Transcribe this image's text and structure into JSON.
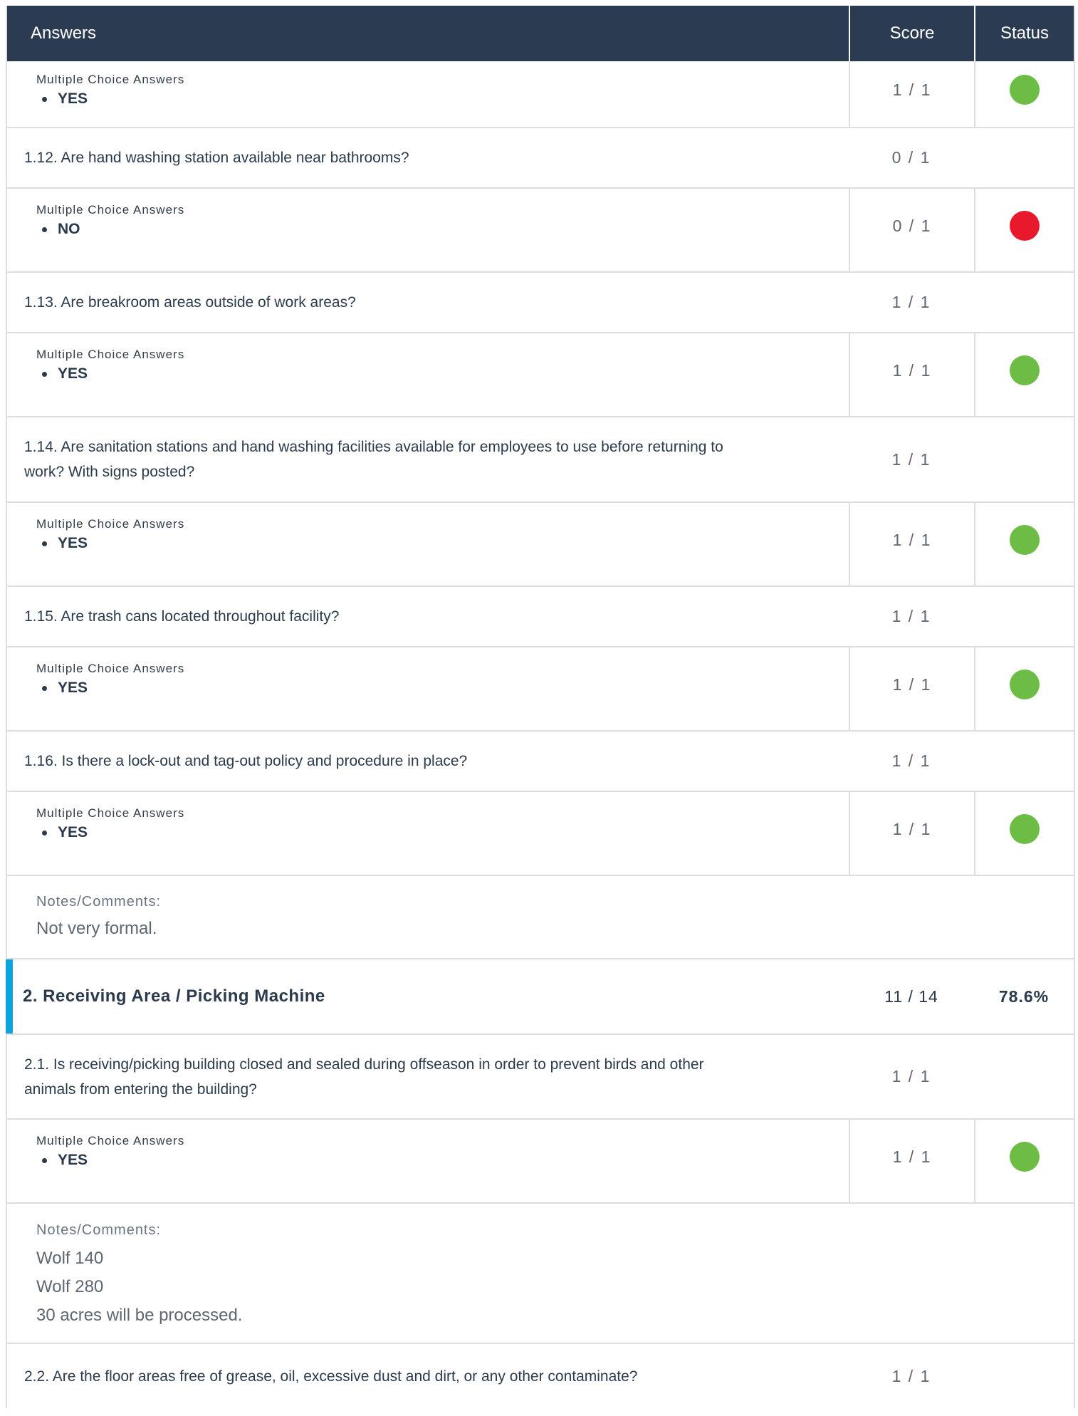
{
  "header": {
    "answers": "Answers",
    "score": "Score",
    "status": "Status"
  },
  "mc_label": "Multiple Choice Answers",
  "notes_label": "Notes/Comments:",
  "rows": {
    "a0": {
      "value": "YES",
      "score": "1 / 1",
      "status": "pass"
    },
    "q12": {
      "text": "1.12. Are hand washing station available near bathrooms?",
      "score": "0 / 1"
    },
    "a12": {
      "value": "NO",
      "score": "0 / 1",
      "status": "fail"
    },
    "q13": {
      "text": "1.13. Are breakroom areas outside of work areas?",
      "score": "1 / 1"
    },
    "a13": {
      "value": "YES",
      "score": "1 / 1",
      "status": "pass"
    },
    "q14": {
      "text_line1": "1.14. Are sanitation stations and hand washing facilities available for employees to use before returning to",
      "text_line2": "work? With signs posted?",
      "score": "1 / 1"
    },
    "a14": {
      "value": "YES",
      "score": "1 / 1",
      "status": "pass"
    },
    "q15": {
      "text": "1.15. Are trash cans located throughout facility?",
      "score": "1 / 1"
    },
    "a15": {
      "value": "YES",
      "score": "1 / 1",
      "status": "pass"
    },
    "q16": {
      "text": "1.16. Is there a lock-out and tag-out policy and procedure in place?",
      "score": "1 / 1"
    },
    "a16": {
      "value": "YES",
      "score": "1 / 1",
      "status": "pass"
    },
    "notes16": {
      "lines": [
        "Not very formal."
      ]
    },
    "section2": {
      "title": "2. Receiving Area / Picking Machine",
      "score": "11 / 14",
      "percent": "78.6%"
    },
    "q21": {
      "text_line1": "2.1. Is receiving/picking building closed and sealed during offseason in order to prevent birds and other",
      "text_line2": "animals from entering the building?",
      "score": "1 / 1"
    },
    "a21": {
      "value": "YES",
      "score": "1 / 1",
      "status": "pass"
    },
    "notes21": {
      "lines": [
        "Wolf 140",
        "Wolf 280",
        "30 acres will be processed."
      ]
    },
    "q22": {
      "text": "2.2. Are the floor areas free of grease, oil, excessive dust and dirt, or any other contaminate?",
      "score": "1 / 1"
    }
  },
  "colors": {
    "header_bg": "#2b3b52",
    "pass": "#6cbc45",
    "fail": "#e8192c",
    "accent": "#0fa3dc"
  }
}
